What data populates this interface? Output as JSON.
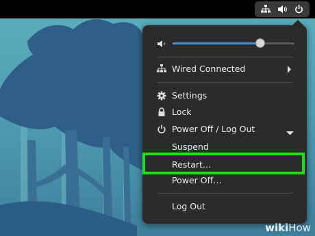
{
  "topbar": {
    "icons": [
      "network-wired-icon",
      "volume-icon",
      "power-icon"
    ]
  },
  "menu": {
    "volume": {
      "icon": "speaker-icon",
      "level": 0.72
    },
    "network": {
      "label": "Wired Connected",
      "icon": "network-wired-icon"
    },
    "settings": {
      "label": "Settings",
      "icon": "gear-icon"
    },
    "lock": {
      "label": "Lock",
      "icon": "lock-icon"
    },
    "power": {
      "label": "Power Off / Log Out",
      "icon": "power-icon",
      "items": [
        "Suspend",
        "Restart…",
        "Power Off…",
        "Log Out"
      ]
    }
  },
  "highlight": {
    "item": "Restart…",
    "color": "#1fe01b"
  },
  "watermark": {
    "brand": "wiki",
    "suffix": "How"
  },
  "colors": {
    "menu_bg": "#2b2b2b",
    "accent": "#4a90d9",
    "highlight": "#1fe01b"
  }
}
